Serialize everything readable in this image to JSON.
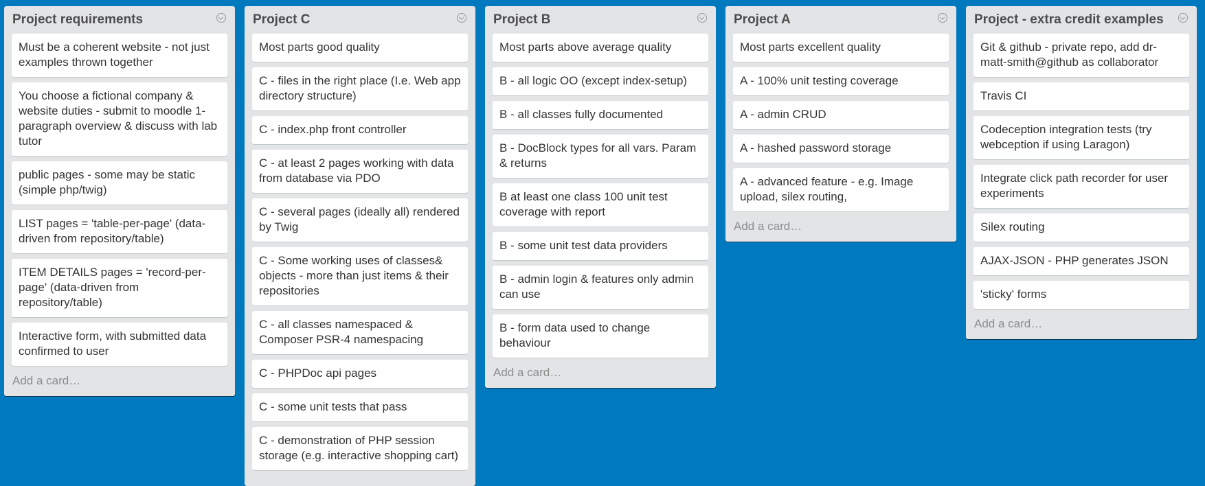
{
  "lists": [
    {
      "title": "Project requirements",
      "cards": [
        "Must be a coherent website - not just examples thrown together",
        "You choose a fictional company & website duties - submit to moodle 1-paragraph overview & discuss with lab tutor",
        "public pages - some may be static (simple php/twig)",
        "LIST pages = 'table-per-page' (data-driven from repository/table)",
        "ITEM DETAILS pages = 'record-per-page' (data-driven from repository/table)",
        "Interactive form, with submitted data confirmed to user"
      ],
      "add_card": "Add a card…"
    },
    {
      "title": "Project C",
      "cards": [
        "Most parts good quality",
        "C - files in the right place (I.e. Web app directory structure)",
        "C - index.php front controller",
        "C - at least 2 pages working with data from database via PDO",
        "C - several pages (ideally all) rendered by Twig",
        "C - Some working uses of classes& objects - more than just items & their repositories",
        "C - all classes namespaced & Composer PSR-4 namespacing",
        "C - PHPDoc api pages",
        "C - some unit tests that pass",
        "C - demonstration of PHP session storage (e.g. interactive shopping cart)"
      ]
    },
    {
      "title": "Project B",
      "cards": [
        "Most parts above average quality",
        "B - all logic OO (except index-setup)",
        "B - all classes fully documented",
        "B - DocBlock types for all vars. Param & returns",
        "B at least one class 100 unit test coverage with report",
        "B - some unit test data providers",
        "B - admin login & features only admin can use",
        "B - form data used to change behaviour"
      ],
      "add_card": "Add a card…"
    },
    {
      "title": "Project A",
      "cards": [
        "Most parts excellent quality",
        "A - 100% unit testing coverage",
        "A - admin CRUD",
        "A - hashed password storage",
        "A - advanced feature - e.g. Image upload, silex routing,"
      ],
      "add_card": "Add a card…"
    },
    {
      "title": "Project - extra credit examples",
      "cards": [
        "Git & github - private repo, add dr-matt-smith@github as collaborator",
        "Travis CI",
        "Codeception integration tests (try webception if using Laragon)",
        "Integrate click path recorder for user experiments",
        "Silex routing",
        "AJAX-JSON - PHP generates JSON",
        "'sticky' forms"
      ],
      "add_card": "Add a card…"
    }
  ]
}
